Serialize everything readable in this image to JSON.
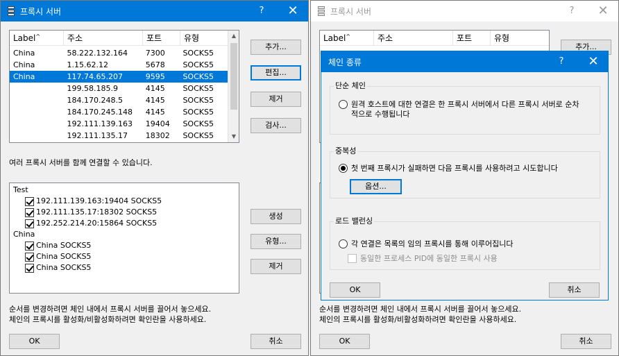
{
  "left_window": {
    "title": "프록시 서버",
    "help": "?",
    "close": "✕",
    "proxy_list": {
      "columns": [
        "Label",
        "주소",
        "포트",
        "유형"
      ],
      "rows": [
        {
          "label": "China",
          "address": "58.222.132.164",
          "port": "7300",
          "type": "SOCKS5",
          "selected": false
        },
        {
          "label": "China",
          "address": "1.15.62.12",
          "port": "5678",
          "type": "SOCKS5",
          "selected": false
        },
        {
          "label": "China",
          "address": "117.74.65.207",
          "port": "9595",
          "type": "SOCKS5",
          "selected": true
        },
        {
          "label": "",
          "address": "199.58.185.9",
          "port": "4145",
          "type": "SOCKS5",
          "selected": false
        },
        {
          "label": "",
          "address": "184.170.248.5",
          "port": "4145",
          "type": "SOCKS5",
          "selected": false
        },
        {
          "label": "",
          "address": "184.170.245.148",
          "port": "4145",
          "type": "SOCKS5",
          "selected": false
        },
        {
          "label": "",
          "address": "192.111.139.163",
          "port": "19404",
          "type": "SOCKS5",
          "selected": false
        },
        {
          "label": "",
          "address": "192.111.135.17",
          "port": "18302",
          "type": "SOCKS5",
          "selected": false
        }
      ]
    },
    "buttons": {
      "add": "추가...",
      "edit": "편집...",
      "remove": "제거",
      "check": "검사...",
      "create": "생성",
      "type": "유형...",
      "remove2": "제거",
      "ok": "OK",
      "cancel": "취소"
    },
    "chain_hint": "여러 프록시 서버를 함께 연결할 수 있습니다.",
    "chains": [
      {
        "name": "Test",
        "items": [
          "192.111.139.163:19404 SOCKS5",
          "192.111.135.17:18302 SOCKS5",
          "192.252.214.20:15864 SOCKS5"
        ]
      },
      {
        "name": "China",
        "items": [
          "China SOCKS5",
          "China SOCKS5",
          "China SOCKS5"
        ]
      }
    ],
    "footer_line1": "순서를 변경하려면 체인 내에서 프록시 서버를 끌어서 놓으세요.",
    "footer_line2": "체인의 프록시를 활성화/비활성화하려면 확인란을 사용하세요."
  },
  "right_window": {
    "title": "프록시 서버",
    "help": "?",
    "close": "✕",
    "columns": [
      "Label",
      "주소",
      "포트",
      "유형"
    ],
    "add": "추가...",
    "footer_line1": "순서를 변경하려면 체인 내에서 프록시 서버를 끌어서 놓으세요.",
    "footer_line2": "체인의 프록시를 활성화/비활성화하려면 확인란을 사용하세요.",
    "ok": "OK",
    "cancel": "취소"
  },
  "chain_dialog": {
    "title": "체인 종류",
    "help": "?",
    "close": "✕",
    "simple": {
      "heading": "단순 체인",
      "text_line1": "원격 호스트에 대한 연결은 한 프록시 서버에서 다른 프록시 서버로 순차",
      "text_line2": "적으로 수행됩니다",
      "checked": false
    },
    "redundancy": {
      "heading": "중복성",
      "text": "첫 번째 프록시가 실패하면 다음 프록시를 사용하려고 시도합니다",
      "checked": true,
      "options": "옵션..."
    },
    "load_balancing": {
      "heading": "로드 밸런싱",
      "text": "각 연결은 목록의 임의 프록시를 통해 이루어집니다",
      "checked": false,
      "same_process": "동일한 프로세스 PID에 동일한 프록시 사용"
    },
    "ok": "OK",
    "cancel": "취소"
  }
}
